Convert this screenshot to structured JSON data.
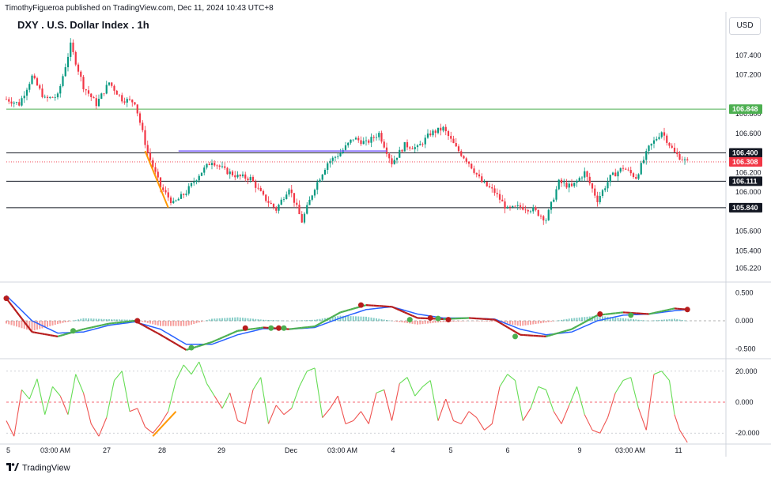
{
  "header": {
    "publish_info": "TimothyFigueroa published on TradingView.com, Dec 11, 2024 10:43 UTC+8",
    "title": "DXY . U.S. Dollar Index . 1h",
    "currency": "USD"
  },
  "footer": {
    "brand": "TradingView"
  },
  "colors": {
    "up": "#089981",
    "down": "#f23645",
    "green_line": "#4caf50",
    "dark_line": "#131722",
    "blue_line": "#2962ff",
    "purple_line": "#7b61ff",
    "orange": "#ff9800"
  },
  "chart_data": [
    {
      "type": "candlestick",
      "symbol": "DXY",
      "interval": "1h",
      "ylim": [
        105.12,
        107.6
      ],
      "y_ticks": [
        "107.400",
        "107.200",
        "106.800",
        "106.600",
        "106.200",
        "106.000",
        "105.600",
        "105.400",
        "105.220"
      ],
      "price_labels": [
        {
          "text": "106.848",
          "value": 106.848,
          "color": "#4caf50",
          "text_color": "#ffffff"
        },
        {
          "text": "106.400",
          "value": 106.4,
          "color": "#131722",
          "text_color": "#ffffff"
        },
        {
          "text": "106.308",
          "value": 106.308,
          "color": "#f23645",
          "text_color": "#ffffff"
        },
        {
          "text": "106.111",
          "value": 106.111,
          "color": "#131722",
          "text_color": "#ffffff"
        },
        {
          "text": "105.840",
          "value": 105.84,
          "color": "#131722",
          "text_color": "#ffffff"
        }
      ],
      "x_ticks": [
        "5",
        "03:00 AM",
        "27",
        "28",
        "29",
        "Dec",
        "03:00 AM",
        "4",
        "5",
        "6",
        "9",
        "03:00 AM",
        "11"
      ],
      "horizontal_lines": [
        {
          "value": 106.848,
          "color": "#4caf50"
        },
        {
          "value": 106.4,
          "color": "#131722"
        },
        {
          "value": 106.111,
          "color": "#131722"
        },
        {
          "value": 105.84,
          "color": "#131722"
        }
      ],
      "key_points": [
        [
          0,
          106.95
        ],
        [
          5,
          106.9
        ],
        [
          10,
          107.18
        ],
        [
          15,
          106.95
        ],
        [
          20,
          106.98
        ],
        [
          25,
          107.5
        ],
        [
          30,
          107.08
        ],
        [
          35,
          106.9
        ],
        [
          40,
          107.12
        ],
        [
          45,
          106.95
        ],
        [
          50,
          106.92
        ],
        [
          55,
          106.4
        ],
        [
          60,
          106.05
        ],
        [
          65,
          105.88
        ],
        [
          70,
          106.0
        ],
        [
          75,
          106.18
        ],
        [
          80,
          106.32
        ],
        [
          85,
          106.22
        ],
        [
          90,
          106.16
        ],
        [
          95,
          106.14
        ],
        [
          100,
          105.95
        ],
        [
          105,
          105.82
        ],
        [
          110,
          106.05
        ],
        [
          115,
          105.7
        ],
        [
          120,
          106.05
        ],
        [
          125,
          106.3
        ],
        [
          130,
          106.4
        ],
        [
          135,
          106.55
        ],
        [
          140,
          106.5
        ],
        [
          145,
          106.6
        ],
        [
          150,
          106.3
        ],
        [
          155,
          106.48
        ],
        [
          160,
          106.45
        ],
        [
          165,
          106.6
        ],
        [
          170,
          106.65
        ],
        [
          175,
          106.45
        ],
        [
          180,
          106.3
        ],
        [
          185,
          106.1
        ],
        [
          190,
          106.0
        ],
        [
          195,
          105.82
        ],
        [
          200,
          105.85
        ],
        [
          205,
          105.82
        ],
        [
          210,
          105.72
        ],
        [
          215,
          106.1
        ],
        [
          220,
          106.05
        ],
        [
          225,
          106.2
        ],
        [
          230,
          105.92
        ],
        [
          235,
          106.15
        ],
        [
          240,
          106.25
        ],
        [
          245,
          106.15
        ],
        [
          250,
          106.45
        ],
        [
          255,
          106.62
        ],
        [
          260,
          106.4
        ],
        [
          265,
          106.3
        ]
      ],
      "annotation_segment": {
        "from": [
          54,
          106.42
        ],
        "to": [
          63,
          105.84
        ],
        "color": "#ff9800"
      },
      "purple_segment": {
        "from": [
          67,
          106.42
        ],
        "to": [
          148,
          106.42
        ],
        "color": "#7b61ff"
      }
    },
    {
      "type": "line",
      "name_hint": "oscillator_macd",
      "ylim": [
        -0.62,
        0.62
      ],
      "y_ticks": [
        "0.500",
        "0.000",
        "-0.500"
      ],
      "fast_points": [
        [
          0,
          0.4
        ],
        [
          10,
          -0.2
        ],
        [
          20,
          -0.28
        ],
        [
          30,
          -0.15
        ],
        [
          40,
          -0.05
        ],
        [
          50,
          0.0
        ],
        [
          60,
          -0.25
        ],
        [
          70,
          -0.52
        ],
        [
          80,
          -0.38
        ],
        [
          90,
          -0.18
        ],
        [
          100,
          -0.12
        ],
        [
          110,
          -0.15
        ],
        [
          120,
          -0.1
        ],
        [
          130,
          0.15
        ],
        [
          140,
          0.28
        ],
        [
          150,
          0.25
        ],
        [
          160,
          0.05
        ],
        [
          170,
          0.03
        ],
        [
          180,
          0.05
        ],
        [
          190,
          0.02
        ],
        [
          200,
          -0.25
        ],
        [
          210,
          -0.28
        ],
        [
          220,
          -0.15
        ],
        [
          230,
          0.1
        ],
        [
          240,
          0.15
        ],
        [
          250,
          0.12
        ],
        [
          260,
          0.22
        ],
        [
          265,
          0.2
        ]
      ],
      "slow_points": [
        [
          0,
          0.45
        ],
        [
          10,
          0.0
        ],
        [
          20,
          -0.22
        ],
        [
          30,
          -0.2
        ],
        [
          40,
          -0.08
        ],
        [
          50,
          -0.02
        ],
        [
          60,
          -0.15
        ],
        [
          70,
          -0.42
        ],
        [
          80,
          -0.42
        ],
        [
          90,
          -0.25
        ],
        [
          100,
          -0.14
        ],
        [
          110,
          -0.15
        ],
        [
          120,
          -0.12
        ],
        [
          130,
          0.05
        ],
        [
          140,
          0.2
        ],
        [
          150,
          0.25
        ],
        [
          160,
          0.12
        ],
        [
          170,
          0.05
        ],
        [
          180,
          0.05
        ],
        [
          190,
          0.03
        ],
        [
          200,
          -0.15
        ],
        [
          210,
          -0.25
        ],
        [
          220,
          -0.2
        ],
        [
          230,
          0.0
        ],
        [
          240,
          0.1
        ],
        [
          250,
          0.12
        ],
        [
          260,
          0.18
        ],
        [
          265,
          0.2
        ]
      ],
      "markers": [
        [
          0,
          0.4,
          "#b71c1c"
        ],
        [
          26,
          -0.18,
          "#4caf50"
        ],
        [
          51,
          0.0,
          "#b71c1c"
        ],
        [
          72,
          -0.48,
          "#4caf50"
        ],
        [
          93,
          -0.13,
          "#b71c1c"
        ],
        [
          103,
          -0.13,
          "#4caf50"
        ],
        [
          106,
          -0.13,
          "#b71c1c"
        ],
        [
          108,
          -0.13,
          "#4caf50"
        ],
        [
          138,
          0.28,
          "#b71c1c"
        ],
        [
          157,
          0.02,
          "#4caf50"
        ],
        [
          165,
          0.05,
          "#b71c1c"
        ],
        [
          168,
          0.04,
          "#4caf50"
        ],
        [
          172,
          0.02,
          "#b71c1c"
        ],
        [
          198,
          -0.28,
          "#4caf50"
        ],
        [
          231,
          0.12,
          "#b71c1c"
        ],
        [
          243,
          0.1,
          "#4caf50"
        ],
        [
          265,
          0.2,
          "#b71c1c"
        ]
      ]
    },
    {
      "type": "line",
      "name_hint": "oscillator_lower",
      "ylim": [
        -26,
        26
      ],
      "y_ticks": [
        "20.000",
        "0.000",
        "-20.000"
      ],
      "points": [
        [
          0,
          -12
        ],
        [
          3,
          -22
        ],
        [
          6,
          8
        ],
        [
          9,
          2
        ],
        [
          12,
          15
        ],
        [
          15,
          -8
        ],
        [
          18,
          10
        ],
        [
          21,
          4
        ],
        [
          24,
          -8
        ],
        [
          27,
          18
        ],
        [
          30,
          6
        ],
        [
          33,
          -14
        ],
        [
          36,
          -22
        ],
        [
          39,
          -10
        ],
        [
          42,
          14
        ],
        [
          45,
          20
        ],
        [
          48,
          -6
        ],
        [
          51,
          -4
        ],
        [
          54,
          -16
        ],
        [
          57,
          -20
        ],
        [
          60,
          -14
        ],
        [
          63,
          -6
        ],
        [
          66,
          14
        ],
        [
          69,
          24
        ],
        [
          72,
          18
        ],
        [
          75,
          26
        ],
        [
          78,
          12
        ],
        [
          81,
          4
        ],
        [
          84,
          -4
        ],
        [
          87,
          6
        ],
        [
          90,
          -12
        ],
        [
          93,
          -14
        ],
        [
          96,
          8
        ],
        [
          99,
          16
        ],
        [
          102,
          -14
        ],
        [
          105,
          -2
        ],
        [
          108,
          -8
        ],
        [
          111,
          -4
        ],
        [
          114,
          10
        ],
        [
          117,
          20
        ],
        [
          120,
          22
        ],
        [
          123,
          -10
        ],
        [
          126,
          -4
        ],
        [
          129,
          4
        ],
        [
          132,
          -14
        ],
        [
          135,
          -12
        ],
        [
          138,
          -6
        ],
        [
          141,
          -14
        ],
        [
          144,
          6
        ],
        [
          147,
          8
        ],
        [
          150,
          -12
        ],
        [
          153,
          12
        ],
        [
          156,
          16
        ],
        [
          159,
          4
        ],
        [
          162,
          10
        ],
        [
          165,
          14
        ],
        [
          168,
          -12
        ],
        [
          171,
          2
        ],
        [
          174,
          -12
        ],
        [
          177,
          -14
        ],
        [
          180,
          -6
        ],
        [
          183,
          -10
        ],
        [
          186,
          -18
        ],
        [
          189,
          -14
        ],
        [
          192,
          10
        ],
        [
          195,
          18
        ],
        [
          198,
          14
        ],
        [
          201,
          -12
        ],
        [
          204,
          -4
        ],
        [
          207,
          10
        ],
        [
          210,
          8
        ],
        [
          213,
          -6
        ],
        [
          216,
          -14
        ],
        [
          219,
          -2
        ],
        [
          222,
          10
        ],
        [
          225,
          -8
        ],
        [
          228,
          -18
        ],
        [
          231,
          -20
        ],
        [
          234,
          -10
        ],
        [
          237,
          6
        ],
        [
          240,
          14
        ],
        [
          243,
          16
        ],
        [
          246,
          -4
        ],
        [
          249,
          -18
        ],
        [
          252,
          18
        ],
        [
          255,
          20
        ],
        [
          258,
          14
        ],
        [
          260,
          -8
        ],
        [
          262,
          -18
        ],
        [
          265,
          -26
        ]
      ],
      "segment": {
        "from": [
          57,
          -22
        ],
        "to": [
          66,
          -6
        ],
        "color": "#ff9800"
      }
    }
  ]
}
